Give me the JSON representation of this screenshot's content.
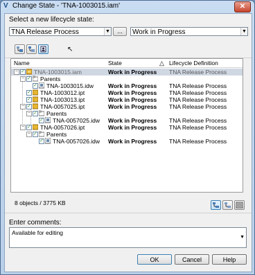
{
  "window": {
    "title": "Change State - 'TNA-1003015.iam'",
    "app_icon": "inventor-v-icon",
    "close_label": "✕"
  },
  "lifecycle": {
    "label": "Select a new lifecycle state:",
    "definition_value": "TNA Release Process",
    "browse_label": "...",
    "state_value": "Work in Progress"
  },
  "toolbar": {
    "buttons": [
      {
        "icon": "show-parents-icon"
      },
      {
        "icon": "show-children-icon"
      },
      {
        "icon": "show-selection-icon"
      }
    ]
  },
  "tree": {
    "columns": {
      "name": "Name",
      "state": "State",
      "lcd": "Lifecycle Definition"
    },
    "rows": [
      {
        "name": "TNA-1003015.iam",
        "state": "Work in Progress",
        "lcd": "TNA Release Process",
        "icon": "assembly-icon",
        "selected": true
      },
      {
        "name": "Parents",
        "state": "",
        "lcd": "",
        "icon": "folder-icon"
      },
      {
        "name": "TNA-1003015.idw",
        "state": "Work in Progress",
        "lcd": "TNA Release Process",
        "icon": "drawing-icon"
      },
      {
        "name": "TNA-1003012.ipt",
        "state": "Work in Progress",
        "lcd": "TNA Release Process",
        "icon": "part-icon"
      },
      {
        "name": "TNA-1003013.ipt",
        "state": "Work in Progress",
        "lcd": "TNA Release Process",
        "icon": "part-icon"
      },
      {
        "name": "TNA-0057025.ipt",
        "state": "Work in Progress",
        "lcd": "TNA Release Process",
        "icon": "part-icon"
      },
      {
        "name": "Parents",
        "state": "",
        "lcd": "",
        "icon": "folder-icon"
      },
      {
        "name": "TNA-0057025.idw",
        "state": "Work in Progress",
        "lcd": "TNA Release Process",
        "icon": "drawing-icon"
      },
      {
        "name": "TNA-0057026.ipt",
        "state": "Work in Progress",
        "lcd": "TNA Release Process",
        "icon": "part-icon"
      },
      {
        "name": "Parents",
        "state": "",
        "lcd": "",
        "icon": "folder-icon"
      },
      {
        "name": "TNA-0057026.idw",
        "state": "Work in Progress",
        "lcd": "TNA Release Process",
        "icon": "drawing-icon"
      }
    ]
  },
  "summary": {
    "count_text": "8 objects / 3775 KB"
  },
  "view_buttons": [
    {
      "icon": "tree-view-icon"
    },
    {
      "icon": "flat-view-icon"
    },
    {
      "icon": "details-view-icon"
    }
  ],
  "comments": {
    "label": "Enter comments:",
    "value": "Available for editing"
  },
  "buttons": {
    "ok": "OK",
    "cancel": "Cancel",
    "help": "Help"
  },
  "colors": {
    "selection": "#cfd7e2",
    "title_bar": "#c9dcf1",
    "close": "#c7452d"
  }
}
